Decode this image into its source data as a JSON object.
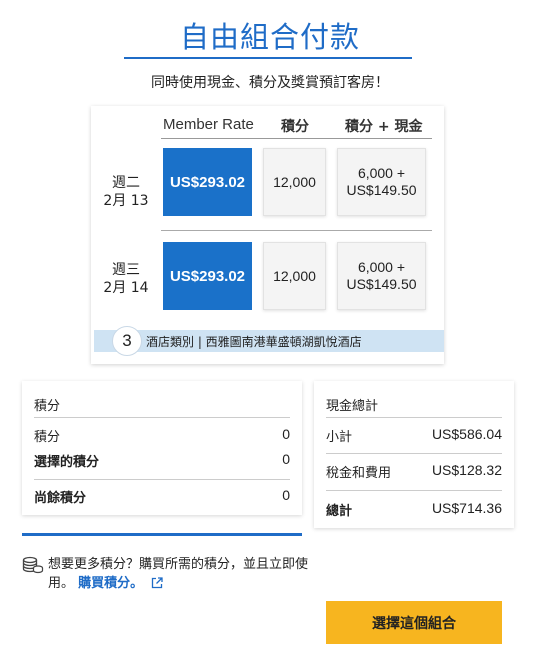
{
  "header": {
    "title": "自由組合付款",
    "subtitle": "同時使用現金、積分及獎賞預訂客房！"
  },
  "rates": {
    "columns": [
      "Member Rate",
      "積分",
      "積分 + 現金"
    ],
    "rows": [
      {
        "weekday": "週二",
        "date": "2月 13",
        "member_rate": "US$293.02",
        "points": "12,000",
        "points_plus": "6,000 +",
        "cash_part": "US$149.50"
      },
      {
        "weekday": "週三",
        "date": "2月 14",
        "member_rate": "US$293.02",
        "points": "12,000",
        "points_plus": "6,000 +",
        "cash_part": "US$149.50"
      }
    ],
    "hotel_category": "3",
    "hotel_info": "酒店類別 | 西雅圖南港華盛頓湖凱悅酒店"
  },
  "points_panel": {
    "title": "積分",
    "points_label": "積分",
    "points_value": "0",
    "selected_label": "選擇的積分",
    "selected_value": "0",
    "remaining_label": "尚餘積分",
    "remaining_value": "0"
  },
  "cash_panel": {
    "title": "現金總計",
    "subtotal_label": "小計",
    "subtotal_value": "US$586.04",
    "tax_label": "稅金和費用",
    "tax_value": "US$128.32",
    "total_label": "總計",
    "total_value": "US$714.36"
  },
  "buy_points": {
    "text": "想要更多積分？購買所需的積分，並且立即使用。",
    "link": "購買積分。"
  },
  "actions": {
    "select_label": "選擇這個組合"
  },
  "colors": {
    "brand_blue": "#1f6cc7",
    "selected_cell": "#1a71c9",
    "cta_yellow": "#f7b51f",
    "hotel_bar": "#cfe3f3"
  }
}
